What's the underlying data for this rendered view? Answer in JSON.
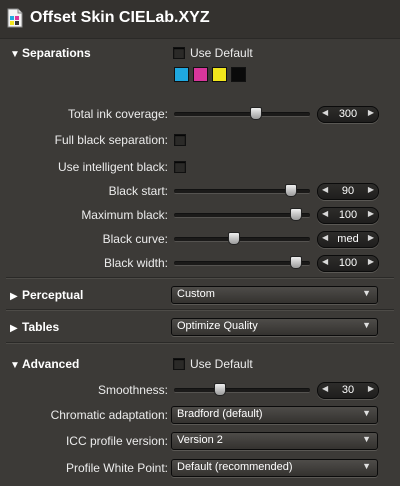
{
  "window": {
    "title": "Offset Skin CIELab.XYZ",
    "icon": "document-icon"
  },
  "colors": {
    "cyan": "#1fa8e0",
    "magenta": "#d8369b",
    "yellow": "#f2e61c",
    "black": "#0a0a0a"
  },
  "separations": {
    "heading": "Separations",
    "use_default_label": "Use Default",
    "use_default_checked": false,
    "inks": [
      "cyan",
      "magenta",
      "yellow",
      "black"
    ],
    "total_ink": {
      "label": "Total ink coverage:",
      "value": "300",
      "level": 0.6
    },
    "full_black": {
      "label": "Full black separation:",
      "checked": false
    },
    "intelligent_black": {
      "label": "Use intelligent black:",
      "checked": false
    },
    "black_start": {
      "label": "Black start:",
      "value": "90",
      "level": 0.88
    },
    "max_black": {
      "label": "Maximum black:",
      "value": "100",
      "level": 0.92
    },
    "black_curve": {
      "label": "Black curve:",
      "value": "med",
      "level": 0.43
    },
    "black_width": {
      "label": "Black width:",
      "value": "100",
      "level": 0.92
    }
  },
  "perceptual": {
    "heading": "Perceptual",
    "selected": "Custom"
  },
  "tables": {
    "heading": "Tables",
    "selected": "Optimize Quality"
  },
  "advanced": {
    "heading": "Advanced",
    "use_default_label": "Use Default",
    "use_default_checked": false,
    "smoothness": {
      "label": "Smoothness:",
      "value": "30",
      "level": 0.32
    },
    "chromatic": {
      "label": "Chromatic adaptation:",
      "selected": "Bradford (default)"
    },
    "icc_version": {
      "label": "ICC profile version:",
      "selected": "Version 2"
    },
    "white_point": {
      "label": "Profile White Point:",
      "selected": "Default (recommended)"
    }
  }
}
